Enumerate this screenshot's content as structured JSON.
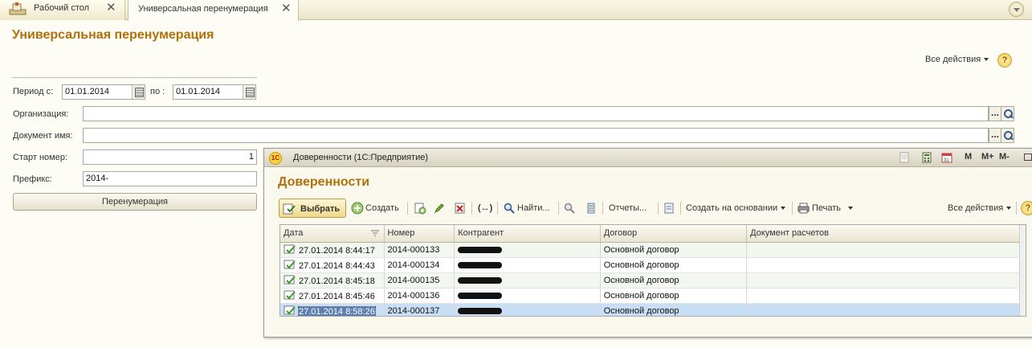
{
  "tabs": [
    {
      "label": "Рабочий стол",
      "close": "✕"
    },
    {
      "label": "Универсальная перенумерация",
      "close": "✕"
    }
  ],
  "form": {
    "title": "Универсальная перенумерация",
    "all_actions": "Все действия",
    "help": "?",
    "period_from_label": "Период с:",
    "period_from_value": "01.01.2014",
    "period_to_label": "по :",
    "period_to_value": "01.01.2014",
    "org_label": "Организация:",
    "org_value": "",
    "doc_label": "Документ имя:",
    "doc_value": "",
    "start_label": "Старт номер:",
    "start_value": "1",
    "prefix_label": "Префикс:",
    "prefix_value": "2014-",
    "dots": "...",
    "renumber_button": "Перенумерация"
  },
  "window": {
    "title": "Доверенности  (1С:Предприятие)",
    "logo": "1С",
    "m_labels": [
      "M",
      "M+",
      "M-"
    ],
    "heading": "Доверенности",
    "toolbar": {
      "select": "Выбрать",
      "create": "Создать",
      "find": "Найти...",
      "reports": "Отчеты...",
      "create_based": "Создать на основании",
      "print": "Печать",
      "all_actions": "Все действия",
      "help": "?"
    },
    "columns": [
      "Дата",
      "Номер",
      "Контрагент",
      "Договор",
      "Документ расчетов"
    ],
    "rows": [
      {
        "date": "27.01.2014 8:44:17",
        "number": "2014-000133",
        "contract": "Основной договор",
        "payment_doc": ""
      },
      {
        "date": "27.01.2014 8:44:43",
        "number": "2014-000134",
        "contract": "Основной договор",
        "payment_doc": ""
      },
      {
        "date": "27.01.2014 8:45:18",
        "number": "2014-000135",
        "contract": "Основной договор",
        "payment_doc": ""
      },
      {
        "date": "27.01.2014 8:45:46",
        "number": "2014-000136",
        "contract": "Основной договор",
        "payment_doc": ""
      },
      {
        "date": "27.01.2014 8:58:26",
        "number": "2014-000137",
        "contract": "Основной договор",
        "payment_doc": ""
      }
    ],
    "selected_row": 4
  },
  "colors": {
    "title": "#b0710b",
    "selection": "#c9dff5"
  }
}
